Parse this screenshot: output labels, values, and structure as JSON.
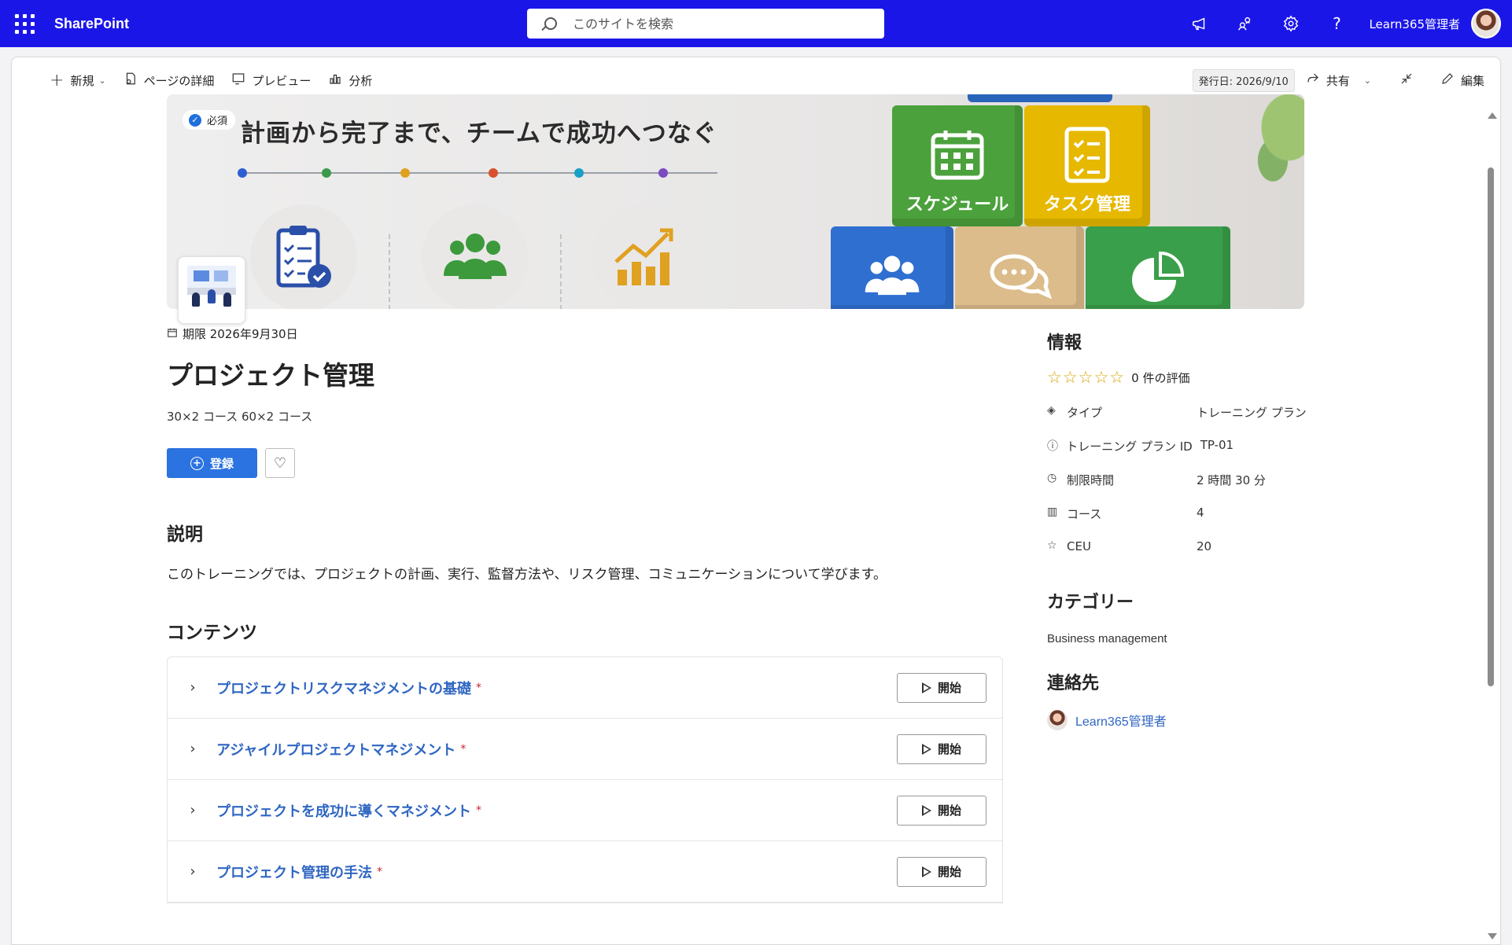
{
  "suitebar": {
    "app_name": "SharePoint",
    "search_placeholder": "このサイトを検索",
    "user_name": "Learn365管理者",
    "icons": [
      "megaphone-icon",
      "people-link-icon",
      "gear-icon",
      "help-icon"
    ]
  },
  "command_bar": {
    "new_label": "新規",
    "page_details_label": "ページの詳細",
    "preview_label": "プレビュー",
    "analytics_label": "分析",
    "published_label": "発行日: 2026/9/10",
    "share_label": "共有",
    "edit_label": "編集"
  },
  "hero": {
    "required_label": "必須",
    "title": "計画から完了まで、チームで成功へつなぐ",
    "block_labels": {
      "schedule": "スケジュール",
      "task": "タスク管理"
    },
    "timeline_colors": [
      "#2d5fd2",
      "#3a9a4a",
      "#e0a020",
      "#d8512c",
      "#1aa0c8",
      "#7a4bc2"
    ]
  },
  "training": {
    "due_label": "期限 2026年9月30日",
    "title": "プロジェクト管理",
    "subtitle": "30×2 コース 60×2 コース",
    "register_label": "登録",
    "description_heading": "説明",
    "description": "このトレーニングでは、プロジェクトの計画、実行、監督方法や、リスク管理、コミュニケーションについて学びます。",
    "contents_heading": "コンテンツ",
    "start_label": "開始",
    "courses": [
      {
        "title": "プロジェクトリスクマネジメントの基礎",
        "required_mark": "*"
      },
      {
        "title": "アジャイルプロジェクトマネジメント",
        "required_mark": "*"
      },
      {
        "title": "プロジェクトを成功に導くマネジメント",
        "required_mark": "*"
      },
      {
        "title": "プロジェクト管理の手法",
        "required_mark": "*"
      }
    ]
  },
  "info": {
    "heading": "情報",
    "rating_text": "0 件の評価",
    "rows": [
      {
        "icon": "layers-icon",
        "label": "タイプ",
        "value": "トレーニング プラン"
      },
      {
        "icon": "info-icon",
        "label": "トレーニング プラン ID",
        "value": "TP-01"
      },
      {
        "icon": "clock-icon",
        "label": "制限時間",
        "value": "2 時間 30 分"
      },
      {
        "icon": "book-icon",
        "label": "コース",
        "value": "4"
      },
      {
        "icon": "star-icon",
        "label": "CEU",
        "value": "20"
      }
    ],
    "category_heading": "カテゴリー",
    "category_value": "Business management",
    "contact_heading": "連絡先",
    "contact_name": "Learn365管理者"
  },
  "colors": {
    "suitebar": "#1b16e8",
    "accent": "#2b73e0",
    "link": "#2f66c2"
  }
}
